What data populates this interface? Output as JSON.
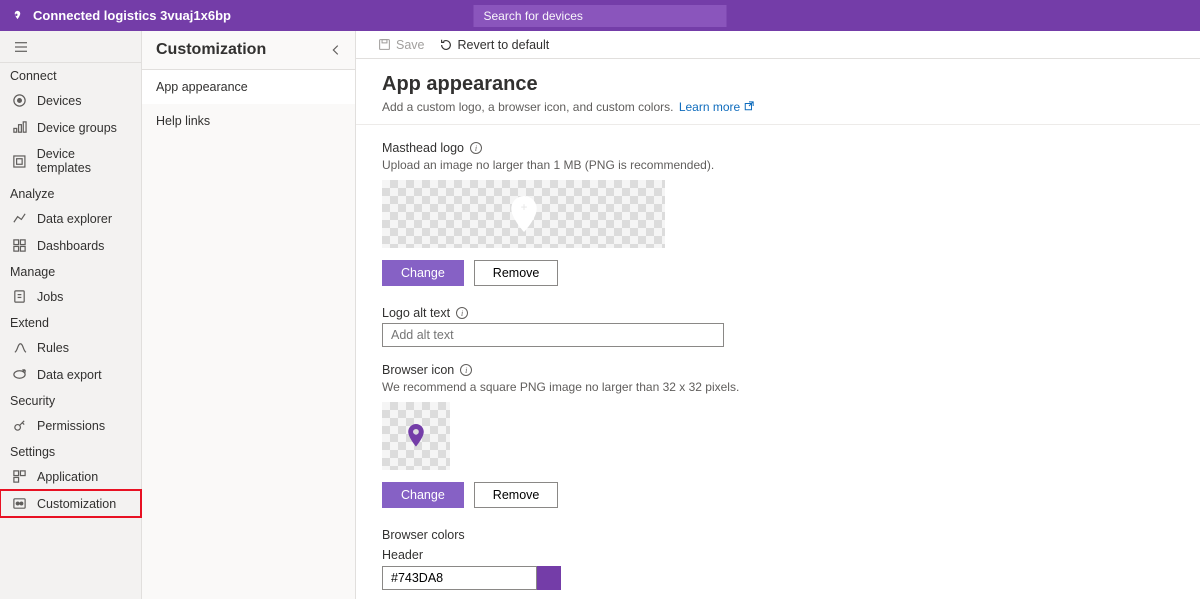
{
  "header": {
    "app_title": "Connected logistics 3vuaj1x6bp",
    "search_placeholder": "Search for devices"
  },
  "leftNav": {
    "sections": [
      {
        "header": "Connect",
        "items": [
          {
            "icon": "devices",
            "label": "Devices"
          },
          {
            "icon": "bar",
            "label": "Device groups"
          },
          {
            "icon": "templates",
            "label": "Device templates"
          }
        ]
      },
      {
        "header": "Analyze",
        "items": [
          {
            "icon": "line",
            "label": "Data explorer"
          },
          {
            "icon": "dash",
            "label": "Dashboards"
          }
        ]
      },
      {
        "header": "Manage",
        "items": [
          {
            "icon": "jobs",
            "label": "Jobs"
          }
        ]
      },
      {
        "header": "Extend",
        "items": [
          {
            "icon": "rules",
            "label": "Rules"
          },
          {
            "icon": "export",
            "label": "Data export"
          }
        ]
      },
      {
        "header": "Security",
        "items": [
          {
            "icon": "perm",
            "label": "Permissions"
          }
        ]
      },
      {
        "header": "Settings",
        "items": [
          {
            "icon": "app",
            "label": "Application"
          },
          {
            "icon": "cust",
            "label": "Customization"
          }
        ]
      }
    ]
  },
  "midCol": {
    "title": "Customization",
    "items": [
      "App appearance",
      "Help links"
    ],
    "activeIndex": 0
  },
  "cmdbar": {
    "save": "Save",
    "revert": "Revert to default"
  },
  "page": {
    "title": "App appearance",
    "subtitle": "Add a custom logo, a browser icon, and custom colors.",
    "learn": "Learn more"
  },
  "form": {
    "masthead_label": "Masthead logo",
    "masthead_help": "Upload an image no larger than 1 MB (PNG is recommended).",
    "change": "Change",
    "remove": "Remove",
    "alt_label": "Logo alt text",
    "alt_placeholder": "Add alt text",
    "icon_label": "Browser icon",
    "icon_help": "We recommend a square PNG image no larger than 32 x 32 pixels.",
    "colors_label": "Browser colors",
    "header_color_label": "Header",
    "header_color": "#743DA8"
  }
}
